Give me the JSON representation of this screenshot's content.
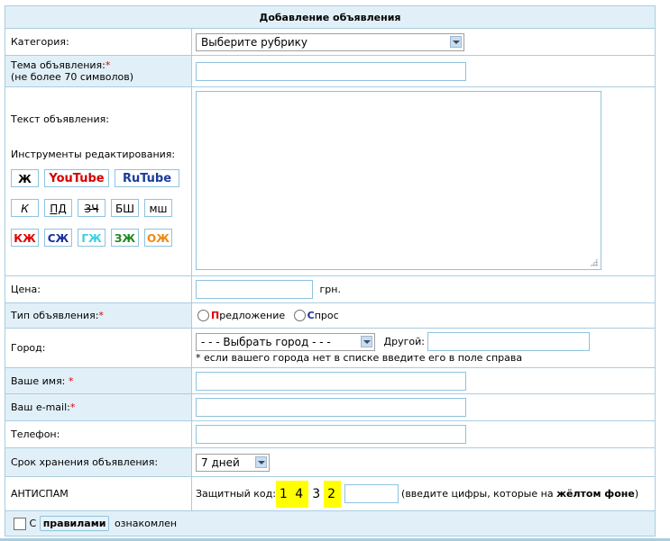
{
  "form_title": "Добавление объявления",
  "fields": {
    "category": {
      "label": "Категория:",
      "value": "Выберите рубрику"
    },
    "subject": {
      "label": "Тема объявления:",
      "required_mark": "*",
      "hint": "(не более 70 символов)",
      "value": ""
    },
    "text": {
      "label": "Текст объявления:",
      "tools_label": "Инструменты редактирования:",
      "value": ""
    },
    "price": {
      "label": "Цена:",
      "value": "",
      "unit": "грн."
    },
    "ad_type": {
      "label": "Тип объявления:",
      "required_mark": "*",
      "option_offer_first": "П",
      "option_offer_rest": "редложение",
      "option_demand_first": "С",
      "option_demand_rest": "прос"
    },
    "city": {
      "label": "Город:",
      "value": "- - - Выбрать город - - -",
      "other_label": "Другой:",
      "other_value": "",
      "note": "* если вашего города нет в списке введите его в поле справа"
    },
    "name": {
      "label": "Ваше имя:",
      "required_mark": "*",
      "value": ""
    },
    "email": {
      "label": "Ваш e-mail:",
      "required_mark": "*",
      "value": ""
    },
    "phone": {
      "label": "Телефон:",
      "value": ""
    },
    "duration": {
      "label": "Срок хранения объявления:",
      "value": "7 дней"
    },
    "antispam": {
      "label": "АНТИСПАМ",
      "code_label": "Защитный код:",
      "code_part1": "1 4",
      "code_plain": "3",
      "code_part2": "2",
      "value": "",
      "hint_prefix": "(введите цифры, которые на ",
      "hint_bold": "жёлтом фоне",
      "hint_suffix": ")"
    }
  },
  "tools": {
    "bold": "Ж",
    "youtube": "YouTube",
    "rutube": "RuTube",
    "italic": "К",
    "underline": "ПД",
    "strike": "ЗЧ",
    "big": "БШ",
    "small": "мш",
    "red": "КЖ",
    "blue": "СЖ",
    "cyan": "ГЖ",
    "green": "ЗЖ",
    "orange": "ОЖ"
  },
  "agree": {
    "prefix": "С",
    "rules_button": "правилами",
    "suffix": "ознакомлен"
  },
  "colors": {
    "header_bg": "#e1f0f8",
    "border": "#a9cde0",
    "required": "#e00000",
    "code_bg": "#ffff00"
  }
}
